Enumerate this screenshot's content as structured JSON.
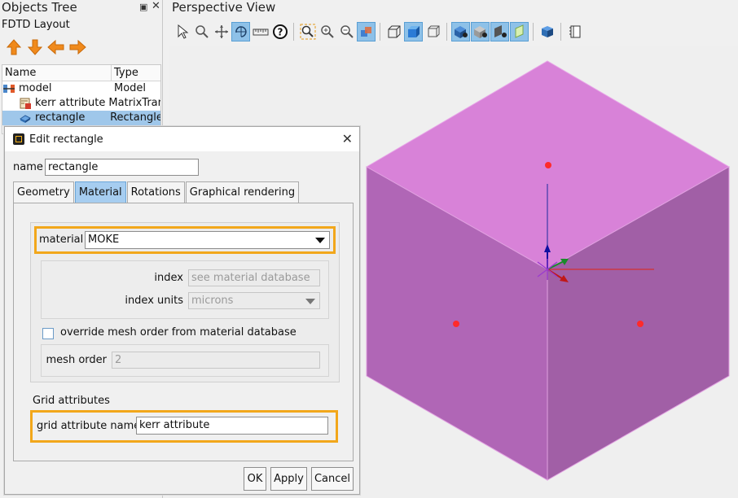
{
  "objects_tree": {
    "title": "Objects Tree",
    "layout_label": "FDTD Layout",
    "columns": [
      "Name",
      "Type"
    ],
    "rows": [
      {
        "name": "model",
        "type": "Model",
        "icon": "model-icon",
        "selected": false,
        "indent": 0
      },
      {
        "name": "kerr attribute",
        "type": "MatrixTran",
        "icon": "attribute-icon",
        "selected": false,
        "indent": 1
      },
      {
        "name": "rectangle",
        "type": "Rectangle",
        "icon": "rectangle-icon",
        "selected": true,
        "indent": 1
      }
    ],
    "arrow_colors": "#f08a1c"
  },
  "view": {
    "title": "Perspective View",
    "object_color": "#d67ed6"
  },
  "dialog": {
    "title": "Edit rectangle",
    "name_label": "name",
    "name_value": "rectangle",
    "tabs": [
      "Geometry",
      "Material",
      "Rotations",
      "Graphical rendering"
    ],
    "active_tab": "Material",
    "material_label": "material",
    "material_value": "MOKE",
    "index_label": "index",
    "index_placeholder": "see material database",
    "index_units_label": "index units",
    "index_units_value": "microns",
    "override_label": "override mesh order from material database",
    "override_checked": false,
    "mesh_order_label": "mesh order",
    "mesh_order_value": "2",
    "grid_section_title": "Grid attributes",
    "grid_attr_label": "grid attribute name",
    "grid_attr_value": "kerr attribute",
    "highlight_color": "#f2a71b",
    "buttons": {
      "ok": "OK",
      "apply": "Apply",
      "cancel": "Cancel"
    }
  }
}
